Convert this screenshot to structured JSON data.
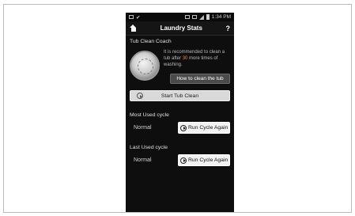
{
  "status_bar": {
    "time": "1:34 PM"
  },
  "title_bar": {
    "title": "Laundry Stats",
    "help": "?"
  },
  "coach": {
    "heading": "Tub Clean Coach",
    "message_before": "It is recommended to clean a tub after ",
    "remaining": "30",
    "message_after": " more times of washing.",
    "howto_label": "How to clean the tub"
  },
  "start_button": {
    "label": "Start Tub Clean"
  },
  "most_used": {
    "heading": "Most Used cycle",
    "value": "Normal",
    "button_label": "Run Cycle Again"
  },
  "last_used": {
    "heading": "Last Used cycle",
    "value": "Normal",
    "button_label": "Run Cycle Again"
  }
}
